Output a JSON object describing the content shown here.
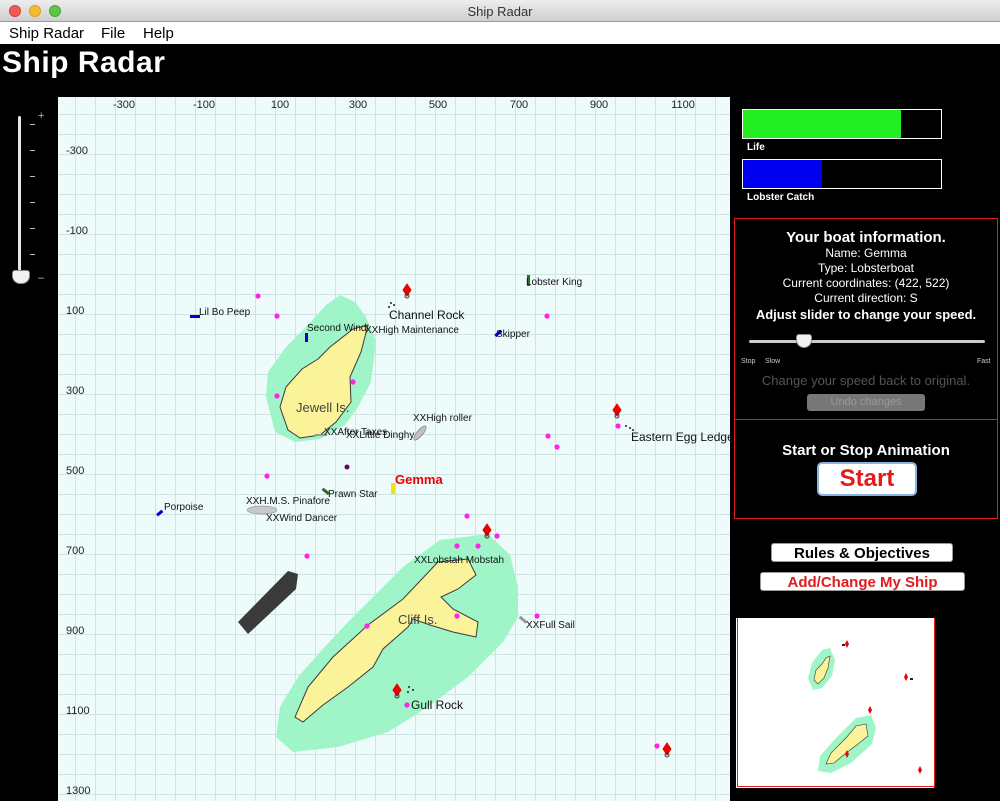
{
  "window": {
    "title": "Ship Radar"
  },
  "menu": {
    "items": [
      "Ship Radar",
      "File",
      "Help"
    ]
  },
  "app": {
    "title": "Ship Radar"
  },
  "zoom": {
    "plus": "+",
    "minus": "–",
    "level_fraction": 0.0
  },
  "map": {
    "x_ticks": [
      "-300",
      "-100",
      "100",
      "300",
      "500",
      "700",
      "900",
      "1100"
    ],
    "y_ticks": [
      "-300",
      "-100",
      "100",
      "300",
      "500",
      "700",
      "900",
      "1100",
      "1300"
    ],
    "islands": [
      {
        "name": "Jewell Is."
      },
      {
        "name": "Cliff Is."
      }
    ],
    "landmarks": [
      {
        "name": "Channel Rock"
      },
      {
        "name": "Eastern Egg Ledge"
      },
      {
        "name": "Gull Rock"
      }
    ],
    "ships": [
      {
        "name": "Lobster King",
        "color": "#2e6b2e"
      },
      {
        "name": "Lil Bo Peep",
        "color": "#0000cc"
      },
      {
        "name": "Second Wind",
        "color": "#0000cc"
      },
      {
        "name": "XXHigh Maintenance",
        "color": "#888888"
      },
      {
        "name": "Skipper",
        "color": "#0000cc"
      },
      {
        "name": "XXHigh roller",
        "color": "#999999"
      },
      {
        "name": "XXAfter Taxes",
        "color": "#999999"
      },
      {
        "name": "XXLittle Dinghy",
        "color": "#999999"
      },
      {
        "name": "Gemma",
        "color": "#e01c1c"
      },
      {
        "name": "Prawn Star",
        "color": "#2e6b2e"
      },
      {
        "name": "Porpoise",
        "color": "#0000cc"
      },
      {
        "name": "XXH.M.S. Pinafore",
        "color": "#999999"
      },
      {
        "name": "XXWind Dancer",
        "color": "#999999"
      },
      {
        "name": "XXLobstah Mobstah",
        "color": "#999999"
      },
      {
        "name": "XXFull Sail",
        "color": "#999999"
      }
    ],
    "colors": {
      "water": "#eefbfb",
      "grid": "#cfe3e3",
      "shoal": "#9ff5c8",
      "land": "#fbf39a",
      "buoy": "#ff22ee",
      "marker": "#ee0000"
    }
  },
  "status": {
    "life_label": "Life",
    "life_fraction": 0.8,
    "life_color": "#22ee22",
    "catch_label": "Lobster Catch",
    "catch_fraction": 0.4,
    "catch_color": "#0000ee"
  },
  "boat_info": {
    "heading": "Your boat information.",
    "name_line": "Name: Gemma",
    "type_line": "Type: Lobsterboat",
    "coords_line": "Current coordinates: (422, 522)",
    "direction_line": "Current direction: S",
    "speed_instruction": "Adjust slider to change your speed.",
    "speed_labels": [
      "Stop",
      "Slow",
      "Fast"
    ],
    "speed_fraction": 0.25,
    "change_back": "Change your speed back to original.",
    "undo_label": "Undo changes"
  },
  "animation": {
    "heading": "Start or Stop Animation",
    "start_label": "Start"
  },
  "buttons": {
    "rules": "Rules & Objectives",
    "add_ship": "Add/Change My Ship"
  }
}
